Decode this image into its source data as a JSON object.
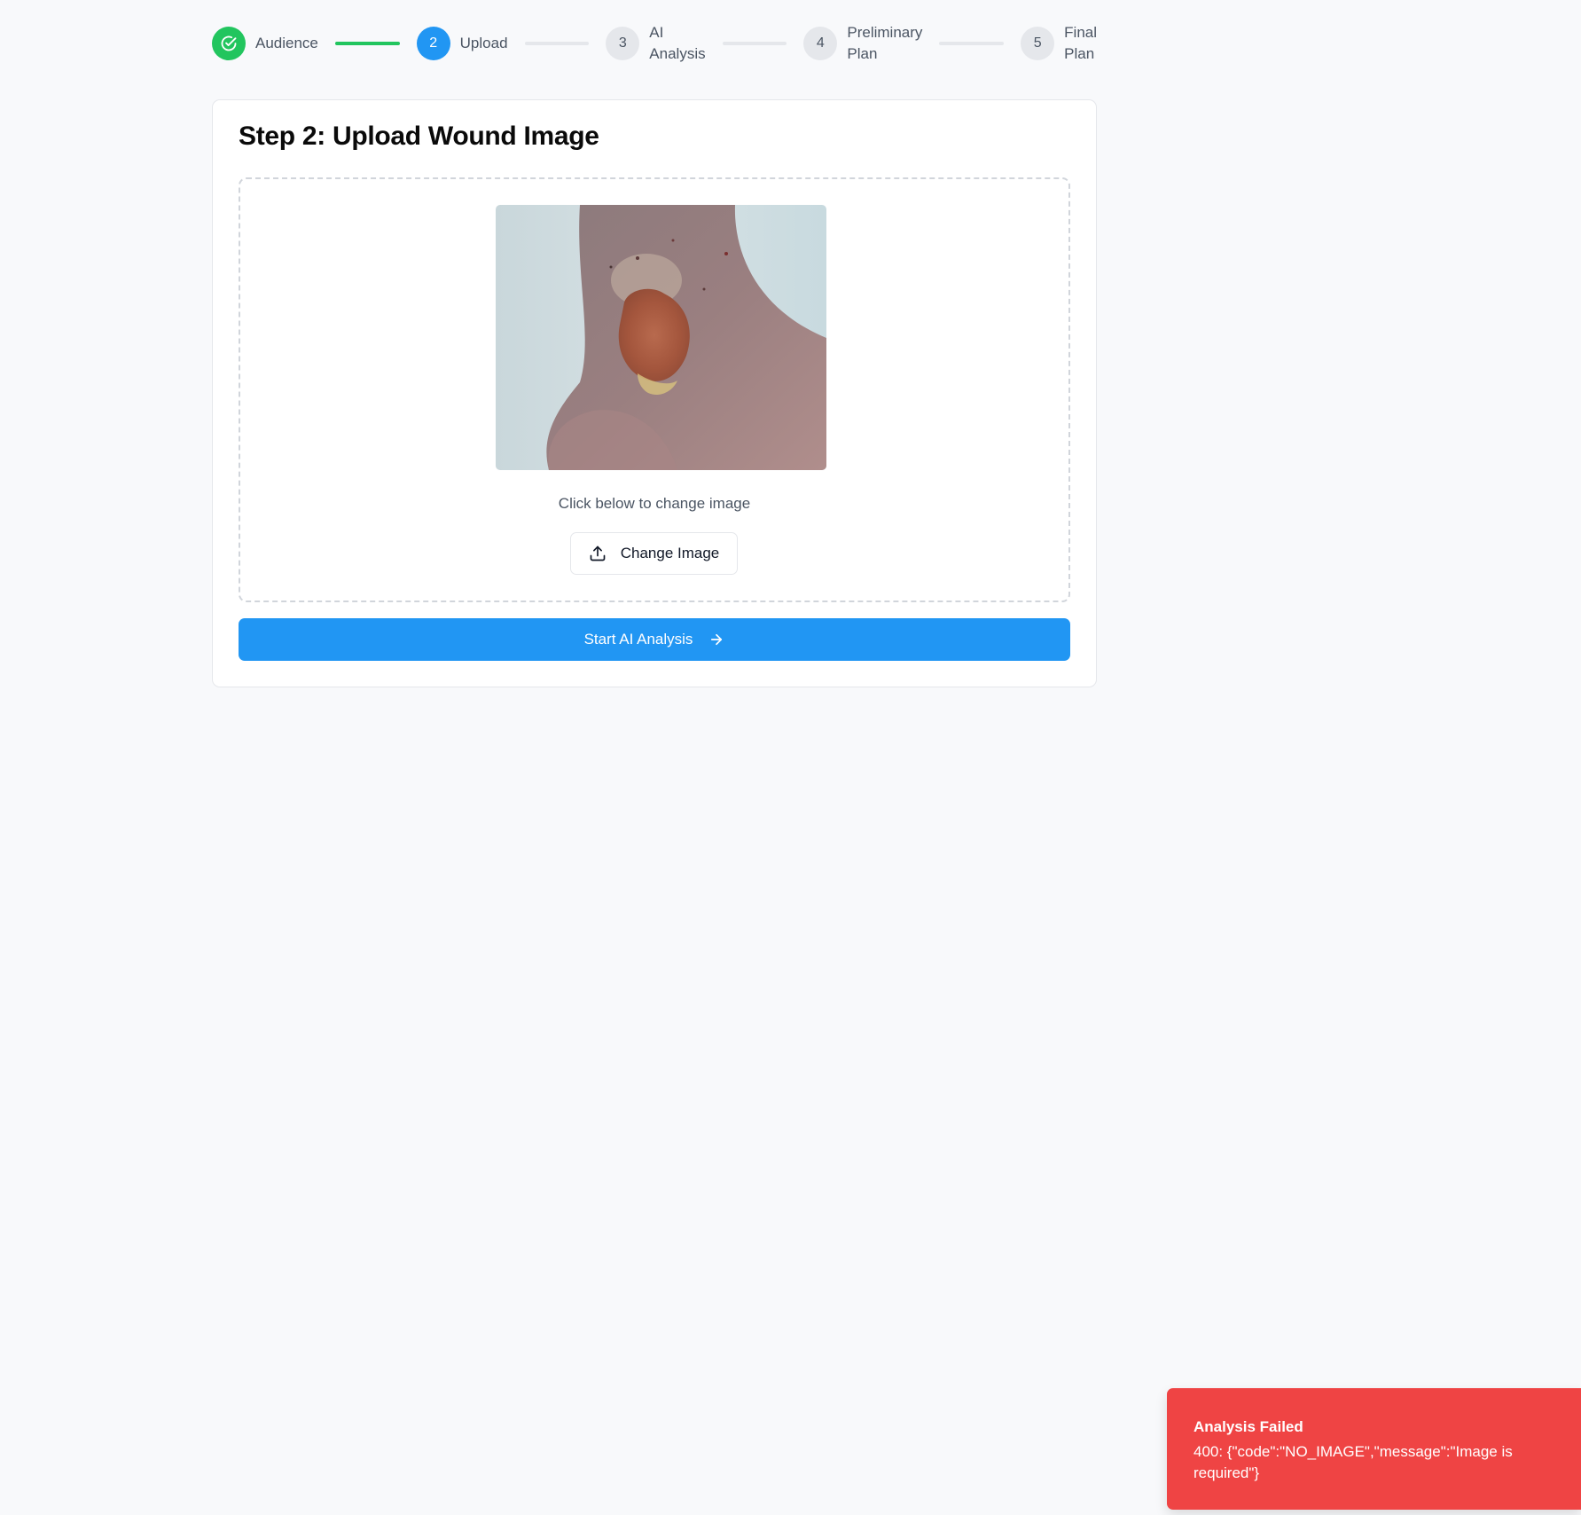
{
  "stepper": {
    "steps": [
      {
        "number": "",
        "label": "Audience",
        "state": "completed",
        "icon": "check-circle-icon"
      },
      {
        "number": "2",
        "label": "Upload",
        "state": "active"
      },
      {
        "number": "3",
        "label": "AI\nAnalysis",
        "state": "pending"
      },
      {
        "number": "4",
        "label": "Preliminary\nPlan",
        "state": "pending"
      },
      {
        "number": "5",
        "label": "Final\nPlan",
        "state": "pending"
      }
    ]
  },
  "card": {
    "title": "Step 2: Upload Wound Image",
    "hint": "Click below to change image",
    "change_button_label": "Change Image",
    "change_button_icon": "upload-icon",
    "start_button_label": "Start AI Analysis",
    "start_button_icon": "arrow-right-icon"
  },
  "toast": {
    "title": "Analysis Failed",
    "message": "400: {\"code\":\"NO_IMAGE\",\"message\":\"Image is required\"}"
  },
  "colors": {
    "primary": "#2196f3",
    "success": "#22c55e",
    "error": "#ef4444",
    "background": "#f8f9fb"
  }
}
